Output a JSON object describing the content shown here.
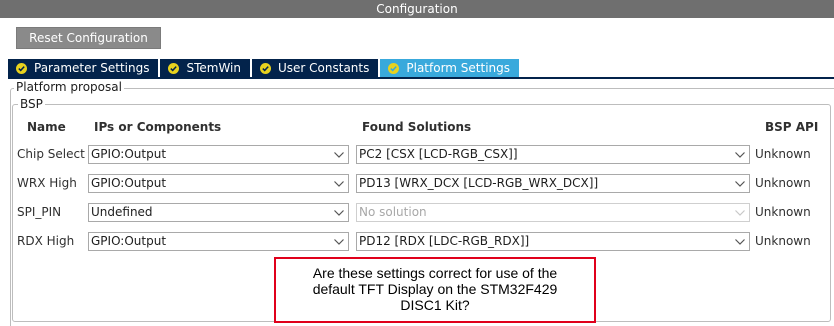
{
  "window": {
    "title": "Configuration"
  },
  "toolbar": {
    "reset_label": "Reset Configuration"
  },
  "tabs": [
    {
      "label": "Parameter Settings",
      "active": false,
      "icon": "check-circle-icon"
    },
    {
      "label": "STemWin",
      "active": false,
      "icon": "check-circle-icon"
    },
    {
      "label": "User Constants",
      "active": false,
      "icon": "check-circle-icon"
    },
    {
      "label": "Platform Settings",
      "active": true,
      "icon": "check-circle-icon"
    }
  ],
  "platform_proposal": {
    "legend": "Platform proposal",
    "bsp": {
      "legend": "BSP",
      "headers": {
        "name": "Name",
        "ips": "IPs or Components",
        "solutions": "Found Solutions",
        "api": "BSP API"
      },
      "rows": [
        {
          "name": "Chip Select",
          "ip": "GPIO:Output",
          "solution": "PC2 [CSX [LCD-RGB_CSX]]",
          "solution_disabled": false,
          "api": "Unknown"
        },
        {
          "name": "WRX High",
          "ip": "GPIO:Output",
          "solution": "PD13 [WRX_DCX [LCD-RGB_WRX_DCX]]",
          "solution_disabled": false,
          "api": "Unknown"
        },
        {
          "name": "SPI_PIN",
          "ip": "Undefined",
          "solution": "No solution",
          "solution_disabled": true,
          "api": "Unknown"
        },
        {
          "name": "RDX High",
          "ip": "GPIO:Output",
          "solution": "PD12 [RDX [LDC-RGB_RDX]]",
          "solution_disabled": false,
          "api": "Unknown"
        }
      ]
    }
  },
  "annotation": {
    "lines": [
      "Are these settings correct for use of the",
      "default TFT Display on the STM32F429",
      "DISC1 Kit?"
    ],
    "border_color": "#e0001b"
  },
  "colors": {
    "titlebar": "#6f6f6f",
    "tab": "#03234b",
    "tab_active": "#39a9dc",
    "check": "#e8d21e"
  }
}
